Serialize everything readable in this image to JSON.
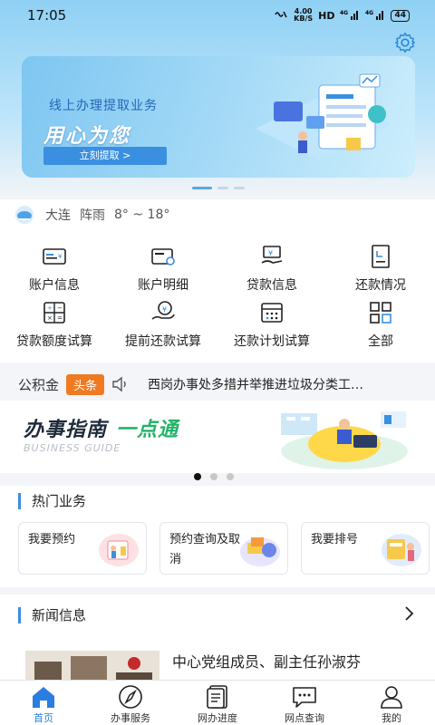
{
  "status_bar": {
    "time": "17:05",
    "speed_value": "4.00",
    "speed_unit": "KB/S",
    "hd": "HD",
    "net1": "4G",
    "net2": "4G",
    "battery": "44"
  },
  "banner": {
    "subtitle": "线上办理提取业务",
    "title": "用心为您",
    "button": "立刻提取 >"
  },
  "weather": {
    "city": "大连",
    "condition": "阵雨",
    "temp": "8° ~ 18°"
  },
  "services": [
    {
      "label": "账户信息",
      "icon": "account-card-icon"
    },
    {
      "label": "账户明细",
      "icon": "account-detail-icon"
    },
    {
      "label": "贷款信息",
      "icon": "loan-info-icon"
    },
    {
      "label": "还款情况",
      "icon": "repayment-doc-icon"
    },
    {
      "label": "贷款额度试算",
      "icon": "calculator-icon"
    },
    {
      "label": "提前还款试算",
      "icon": "hand-coin-icon"
    },
    {
      "label": "还款计划试算",
      "icon": "calendar-grid-icon"
    },
    {
      "label": "全部",
      "icon": "all-apps-icon"
    }
  ],
  "ticker": {
    "label": "公积金",
    "tag": "头条",
    "text": "西岗办事处多措并举推进垃圾分类工…"
  },
  "guide": {
    "title_a": "办事指南",
    "title_b": "一点通",
    "subtitle": "BUSINESS GUIDE"
  },
  "hot": {
    "title": "热门业务",
    "cards": [
      {
        "label": "我要预约"
      },
      {
        "label": "预约查询及取消"
      },
      {
        "label": "我要排号"
      }
    ]
  },
  "news": {
    "title": "新闻信息",
    "headline": "中心党组成员、副主任孙淑芬"
  },
  "tabs": [
    {
      "label": "首页",
      "icon": "home-icon"
    },
    {
      "label": "办事服务",
      "icon": "compass-icon"
    },
    {
      "label": "网办进度",
      "icon": "document-icon"
    },
    {
      "label": "网点查询",
      "icon": "chat-bubble-icon"
    },
    {
      "label": "我的",
      "icon": "user-icon"
    }
  ],
  "colors": {
    "accent": "#3b8fe0",
    "tag": "#f07a22",
    "guide_green": "#22b36a"
  }
}
